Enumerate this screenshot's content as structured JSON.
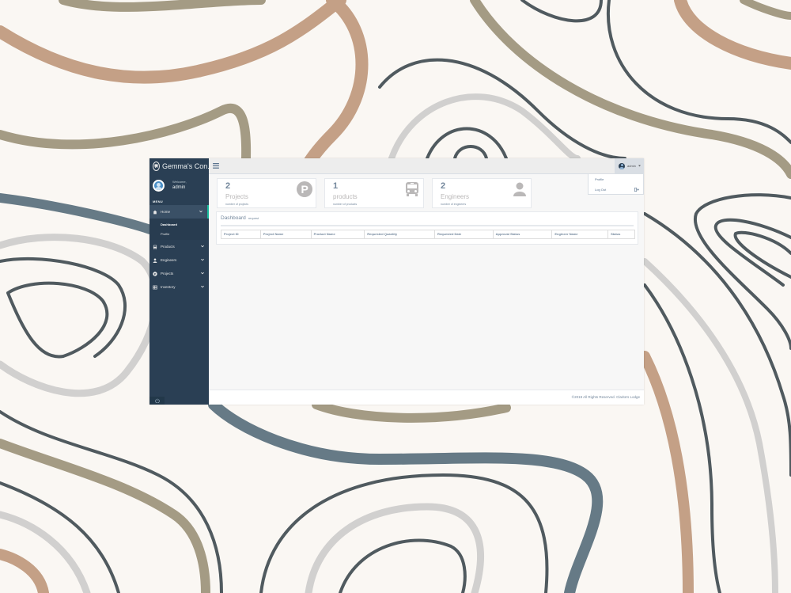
{
  "app": {
    "brand": "Gemma's Con. IS"
  },
  "profile": {
    "welcome": "Welcome,",
    "username": "admin"
  },
  "sidebar": {
    "menu_title": "MENU",
    "items": [
      {
        "label": "Home",
        "icon": "home-icon",
        "expanded": true,
        "children": [
          {
            "label": "Dashboard",
            "current": true
          },
          {
            "label": "Profile"
          }
        ]
      },
      {
        "label": "Products",
        "icon": "bus-icon"
      },
      {
        "label": "Engineers",
        "icon": "user-icon"
      },
      {
        "label": "Projects",
        "icon": "p-circle-icon"
      },
      {
        "label": "Inventory",
        "icon": "table-icon"
      }
    ]
  },
  "topnav": {
    "username": "admin"
  },
  "dropdown": {
    "items": [
      {
        "label": "Profile"
      },
      {
        "label": "Log Out"
      }
    ]
  },
  "tiles": [
    {
      "count": "2",
      "name": "Projects",
      "sub": "number of projects",
      "icon": "p-circle-icon"
    },
    {
      "count": "1",
      "name": "products",
      "sub": "number of products",
      "icon": "bus-icon"
    },
    {
      "count": "2",
      "name": "Engineers",
      "sub": "number of engineers",
      "icon": "user-icon"
    }
  ],
  "panel": {
    "title": "Dashboard",
    "subtitle": "request",
    "columns": [
      "Project ID",
      "Project Name",
      "Product Name",
      "Requested Quantity",
      "Requested Date",
      "Approval Status",
      "Engineer Name",
      "Status"
    ]
  },
  "footer": {
    "text": "©2019 All Rights Reserved. Clarita's Lodge"
  },
  "colors": {
    "sidebar": "#2a3f54",
    "accent": "#1abb9c",
    "muted_text": "#73879c"
  }
}
